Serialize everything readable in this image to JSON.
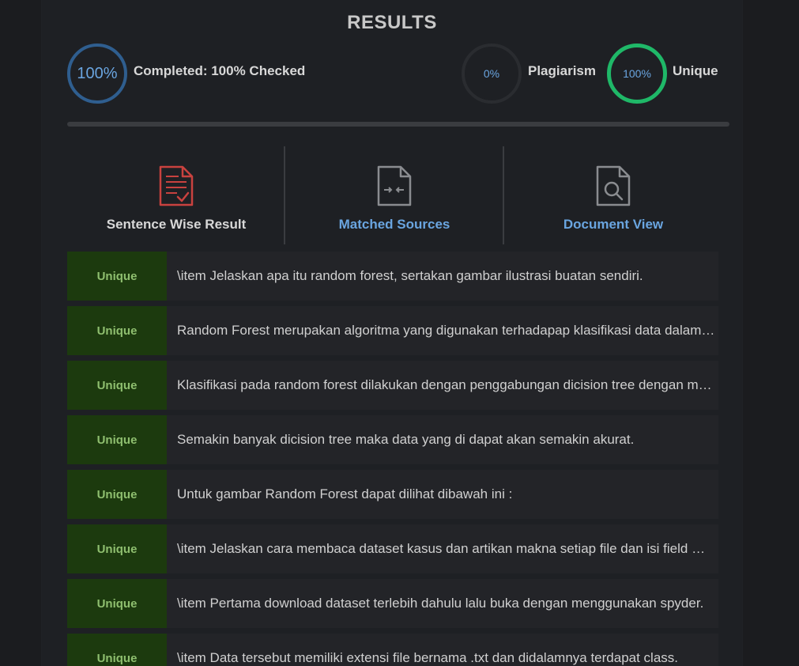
{
  "header": {
    "title": "RESULTS"
  },
  "stats": {
    "completed": {
      "circle_text": "100%",
      "label": "Completed: 100% Checked"
    },
    "plagiarism": {
      "circle_text": "0%",
      "label": "Plagiarism"
    },
    "unique": {
      "circle_text": "100%",
      "label": "Unique"
    }
  },
  "tabs": [
    {
      "label": "Sentence Wise Result",
      "icon": "document-check-icon",
      "color": "#d8d8d8"
    },
    {
      "label": "Matched Sources",
      "icon": "compare-document-icon",
      "color": "#6aa5e0"
    },
    {
      "label": "Document View",
      "icon": "document-search-icon",
      "color": "#6aa5e0"
    }
  ],
  "colors": {
    "accent_blue": "#6aa5e0",
    "unique_green": "#1fb868",
    "badge_bg": "#1c3a0e",
    "badge_text": "#8fbf6f",
    "icon_red": "#c9423f"
  },
  "results": [
    {
      "status": "Unique",
      "text": "\\item Jelaskan apa itu random forest, sertakan gambar ilustrasi buatan sendiri."
    },
    {
      "status": "Unique",
      "text": "Random Forest merupakan algoritma yang digunakan terhadapap klasifikasi data dalam jumlah yang besar."
    },
    {
      "status": "Unique",
      "text": "Klasifikasi pada random forest dilakukan dengan penggabungan dicision tree dengan melakukan training."
    },
    {
      "status": "Unique",
      "text": "Semakin banyak dicision tree maka data yang di dapat akan semakin akurat."
    },
    {
      "status": "Unique",
      "text": "Untuk gambar Random Forest dapat dilihat dibawah ini :"
    },
    {
      "status": "Unique",
      "text": "\\item Jelaskan cara membaca dataset kasus dan artikan makna setiap file dan isi field masing-masing file."
    },
    {
      "status": "Unique",
      "text": "\\item Pertama download dataset terlebih dahulu lalu buka dengan menggunakan spyder."
    },
    {
      "status": "Unique",
      "text": "\\item Data tersebut memiliki extensi file bernama .txt dan didalamnya terdapat class."
    }
  ]
}
